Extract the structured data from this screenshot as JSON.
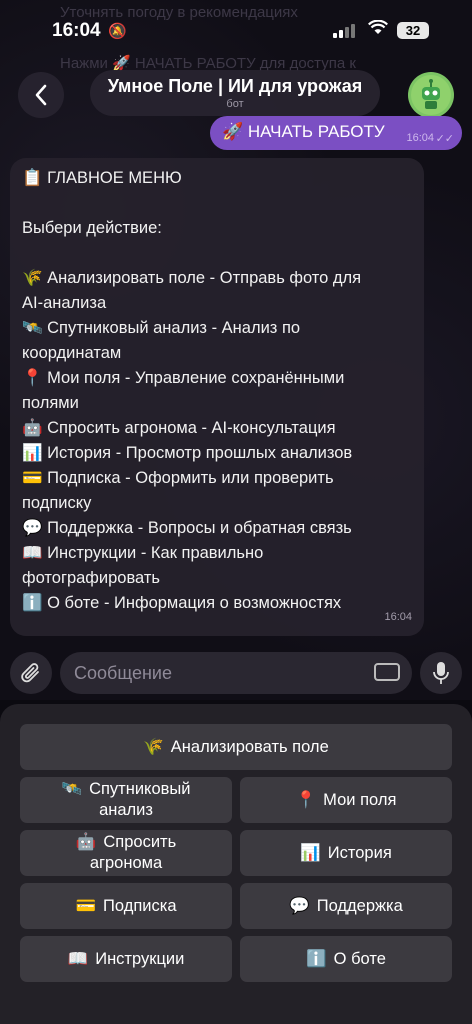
{
  "status_bar": {
    "time": "16:04",
    "battery": "32"
  },
  "background_text": [
    "Уточнять погоду в рекомендациях",
    "Нажми 🚀 НАЧАТЬ РАБОТУ для доступа к"
  ],
  "header": {
    "title": "Умное Поле | ИИ для урожая",
    "subtitle": "бот"
  },
  "outgoing": {
    "text": "🚀 НАЧАТЬ РАБОТУ",
    "time": "16:04"
  },
  "incoming": {
    "lines": [
      "📋 ГЛАВНОЕ МЕНЮ",
      "",
      "Выбери действие:",
      "",
      "🌾 Анализировать поле - Отправь фото для",
      "AI-анализа",
      "🛰️ Спутниковый анализ - Анализ по",
      "координатам",
      "📍 Мои поля - Управление сохранёнными",
      "полями",
      "🤖 Спросить агронома - AI-консультация",
      "📊 История - Просмотр прошлых анализов",
      "💳 Подписка - Оформить или проверить",
      "подписку",
      "💬 Поддержка - Вопросы и обратная связь",
      "📖 Инструкции - Как правильно",
      "фотографировать",
      "ℹ️ О боте - Информация о возможностях"
    ],
    "time": "16:04"
  },
  "input": {
    "placeholder": "Сообщение"
  },
  "keyboard": {
    "analyze": {
      "emoji": "🌾",
      "label": "Анализировать поле"
    },
    "satellite": {
      "emoji": "🛰️",
      "label1": "Спутниковый",
      "label2": "анализ"
    },
    "fields": {
      "emoji": "📍",
      "label": "Мои поля"
    },
    "agronomist": {
      "emoji": "🤖",
      "label1": "Спросить",
      "label2": "агронома"
    },
    "history": {
      "emoji": "📊",
      "label": "История"
    },
    "subscription": {
      "emoji": "💳",
      "label": "Подписка"
    },
    "support": {
      "emoji": "💬",
      "label": "Поддержка"
    },
    "instructions": {
      "emoji": "📖",
      "label": "Инструкции"
    },
    "about": {
      "emoji": "ℹ️",
      "label": "О боте"
    }
  },
  "colors": {
    "accent": "#7b4fc3",
    "bubble": "#25212c",
    "button": "#3c3a40"
  }
}
